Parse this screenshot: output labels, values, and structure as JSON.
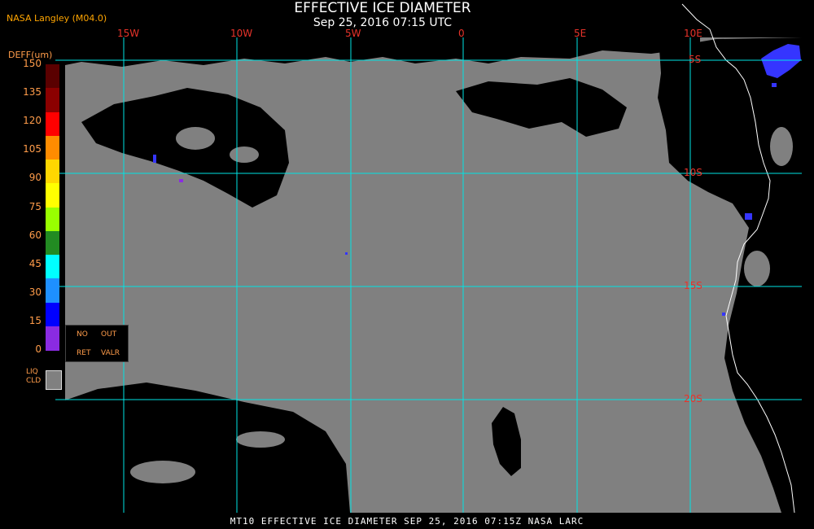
{
  "header": {
    "agency": "NASA Langley (M04.0)",
    "title": "EFFECTIVE ICE DIAMETER",
    "subtitle": "Sep 25, 2016 07:15 UTC"
  },
  "map": {
    "longitude_labels": [
      "15W",
      "10W",
      "5W",
      "0",
      "5E",
      "10E"
    ],
    "latitude_labels": [
      "5S",
      "10S",
      "15S",
      "20S"
    ],
    "colors": {
      "liquid_cloud": "#808080",
      "clear": "#000000",
      "grid": "#00e5e5",
      "coast": "#ffffff",
      "ice_cloud": "#3535ff"
    }
  },
  "colorbar": {
    "title": "DEFF(um)",
    "ticks": [
      "150",
      "135",
      "120",
      "105",
      "90",
      "75",
      "60",
      "45",
      "30",
      "15",
      "0"
    ],
    "colors": [
      "#5a0000",
      "#8b0000",
      "#ff0000",
      "#ff8c00",
      "#ffd700",
      "#ffff00",
      "#99ff00",
      "#228b22",
      "#00ffff",
      "#1e90ff",
      "#0000ff",
      "#8a2be2"
    ]
  },
  "legend": {
    "no_ret_label": "NO",
    "no_ret_label2": "RET",
    "out_valr_label": "OUT",
    "out_valr_label2": "VALR",
    "liq_cld_label": "LIQ",
    "liq_cld_label2": "CLD"
  },
  "footer": {
    "text": "MT10  EFFECTIVE ICE DIAMETER  SEP 25, 2016 07:15Z  NASA LARC"
  }
}
